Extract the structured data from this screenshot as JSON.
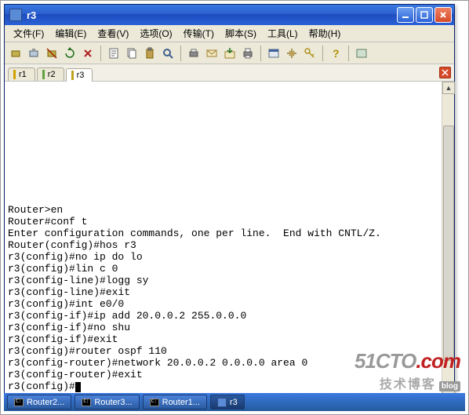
{
  "window": {
    "title": "r3"
  },
  "menubar": {
    "file": "文件(F)",
    "edit": "编辑(E)",
    "view": "查看(V)",
    "option": "选项(O)",
    "transfer": "传输(T)",
    "script": "脚本(S)",
    "tools": "工具(L)",
    "help": "帮助(H)"
  },
  "tabs": {
    "t1": "r1",
    "t2": "r2",
    "t3": "r3"
  },
  "terminal": {
    "lines": [
      "",
      "",
      "",
      "",
      "",
      "",
      "",
      "",
      "",
      "Router>en",
      "Router#conf t",
      "Enter configuration commands, one per line.  End with CNTL/Z.",
      "Router(config)#hos r3",
      "r3(config)#no ip do lo",
      "r3(config)#lin c 0",
      "r3(config-line)#logg sy",
      "r3(config-line)#exit",
      "r3(config)#int e0/0",
      "r3(config-if)#ip add 20.0.0.2 255.0.0.0",
      "r3(config-if)#no shu",
      "r3(config-if)#exit",
      "r3(config)#router ospf 110",
      "r3(config-router)#network 20.0.0.2 0.0.0.0 area 0",
      "r3(config-router)#exit"
    ],
    "prompt": "r3(config)#"
  },
  "taskbar": {
    "t1": "Router2...",
    "t2": "Router3...",
    "t3": "Router1...",
    "t4": "r3"
  },
  "watermark": {
    "brand_a": "51CTO",
    "brand_b": ".com",
    "sub": "技术博客",
    "badge": "blog"
  }
}
